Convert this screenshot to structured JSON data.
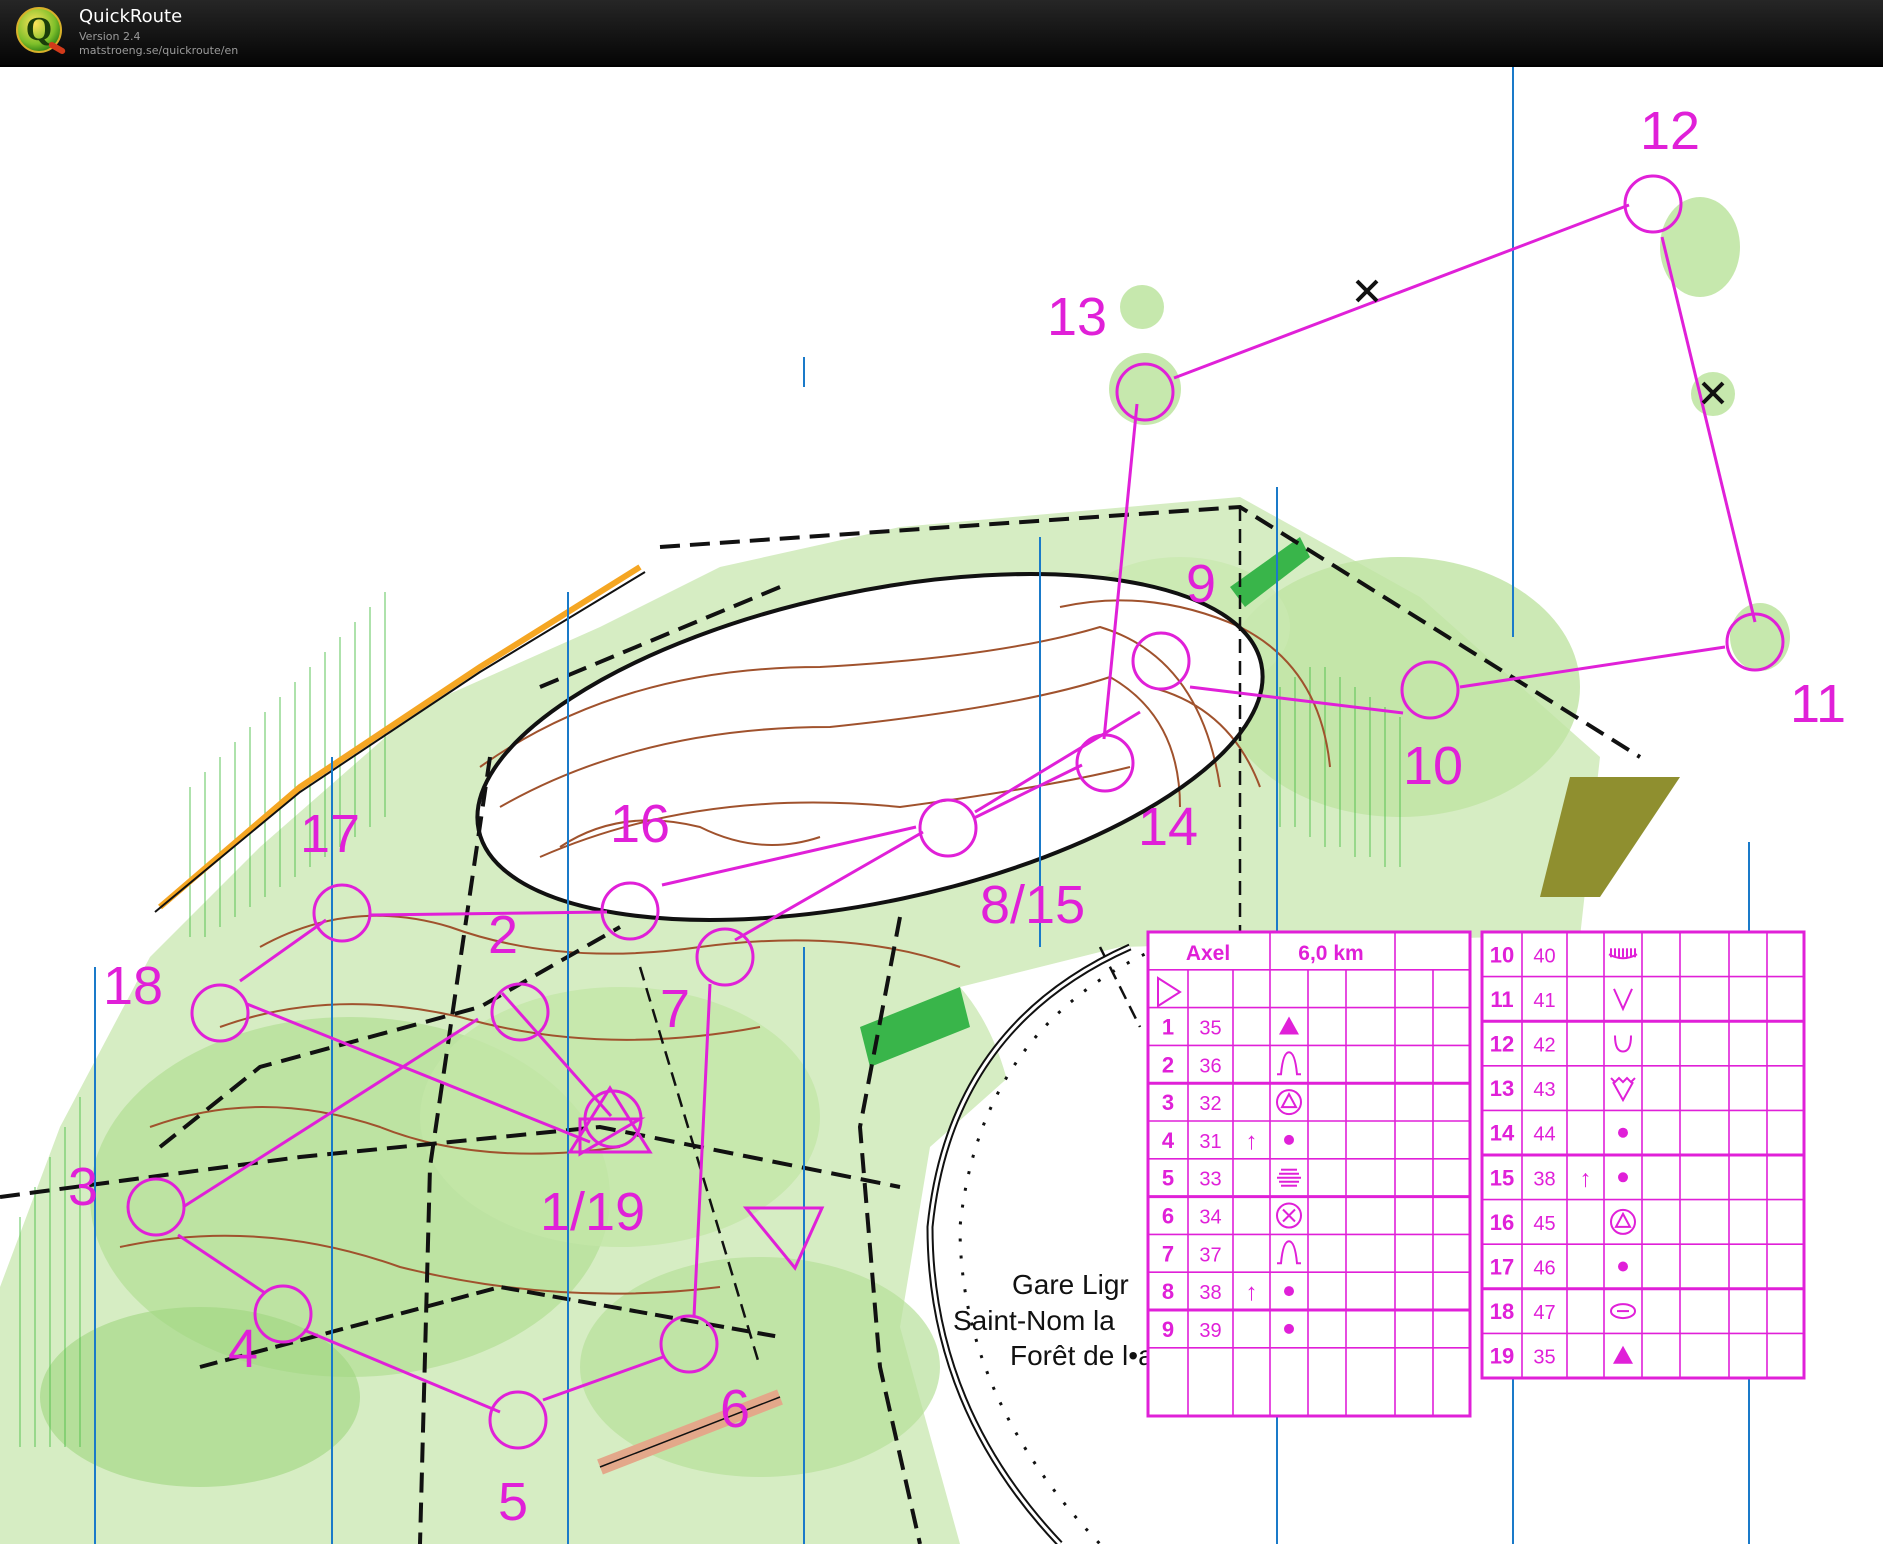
{
  "app": {
    "title": "QuickRoute",
    "version": "Version 2.4",
    "url": "matstroeng.se/quickroute/en"
  },
  "map": {
    "place_lines": [
      "Gare Ligr",
      "Saint-Nom la",
      "Forêt de l•arly"
    ],
    "controls": [
      "12",
      "13",
      "9",
      "11",
      "10",
      "16",
      "14",
      "17",
      "8/15",
      "2",
      "18",
      "7",
      "3",
      "1/19",
      "4",
      "6",
      "5"
    ],
    "course_color": "#e020d8"
  },
  "control_card": {
    "name": "Axel",
    "distance": "6,0 km",
    "left": [
      {
        "num": "1",
        "code": "35",
        "dir": "",
        "symbol": "▲",
        "sym": "triangle"
      },
      {
        "num": "2",
        "code": "36",
        "dir": "",
        "symbol": "",
        "sym": "knoll"
      },
      {
        "num": "3",
        "code": "32",
        "dir": "",
        "symbol": "",
        "sym": "circled-triangle"
      },
      {
        "num": "4",
        "code": "31",
        "dir": "↑",
        "symbol": "•",
        "sym": "dot"
      },
      {
        "num": "5",
        "code": "33",
        "dir": "",
        "symbol": "",
        "sym": "lines"
      },
      {
        "num": "6",
        "code": "34",
        "dir": "",
        "symbol": "",
        "sym": "circled-x"
      },
      {
        "num": "7",
        "code": "37",
        "dir": "",
        "symbol": "",
        "sym": "knoll"
      },
      {
        "num": "8",
        "code": "38",
        "dir": "↑",
        "symbol": "•",
        "sym": "dot"
      },
      {
        "num": "9",
        "code": "39",
        "dir": "",
        "symbol": "•",
        "sym": "dot"
      }
    ],
    "right": [
      {
        "num": "10",
        "code": "40",
        "dir": "",
        "symbol": "",
        "sym": "lashes"
      },
      {
        "num": "11",
        "code": "41",
        "dir": "",
        "symbol": "V",
        "sym": "v"
      },
      {
        "num": "12",
        "code": "42",
        "dir": "",
        "symbol": "∪",
        "sym": "u"
      },
      {
        "num": "13",
        "code": "43",
        "dir": "",
        "symbol": "",
        "sym": "v-hatch"
      },
      {
        "num": "14",
        "code": "44",
        "dir": "",
        "symbol": "•",
        "sym": "dot"
      },
      {
        "num": "15",
        "code": "38",
        "dir": "↑",
        "symbol": "•",
        "sym": "dot"
      },
      {
        "num": "16",
        "code": "45",
        "dir": "",
        "symbol": "",
        "sym": "circled-triangle"
      },
      {
        "num": "17",
        "code": "46",
        "dir": "",
        "symbol": "•",
        "sym": "dot"
      },
      {
        "num": "18",
        "code": "47",
        "dir": "",
        "symbol": "",
        "sym": "oval"
      },
      {
        "num": "19",
        "code": "35",
        "dir": "",
        "symbol": "▲",
        "sym": "triangle"
      }
    ]
  }
}
